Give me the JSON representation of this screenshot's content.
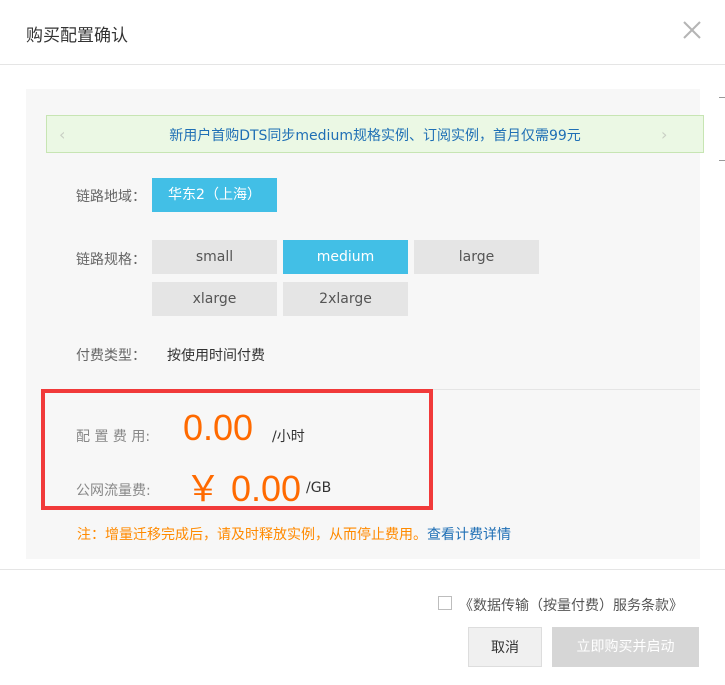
{
  "dialog": {
    "title": "购买配置确认"
  },
  "promo": {
    "text": "新用户首购DTS同步medium规格实例、订阅实例，首月仅需99元",
    "prev_glyph": "‹",
    "next_glyph": "›"
  },
  "region": {
    "label": "链路地域：",
    "selected": "华东2（上海）"
  },
  "spec": {
    "label": "链路规格：",
    "options": [
      "small",
      "medium",
      "large",
      "xlarge",
      "2xlarge"
    ],
    "selected": "medium"
  },
  "payment": {
    "label": "付费类型：",
    "value": "按使用时间付费"
  },
  "fees": {
    "config_label": "配 置 费 用:",
    "config_value": "0.00",
    "config_unit": "/小时",
    "traffic_label": "公网流量费:",
    "traffic_value": "￥ 0.00",
    "traffic_unit": "/GB"
  },
  "note": {
    "text": "注：增量迁移完成后，请及时释放实例，从而停止费用。",
    "link": "查看计费详情"
  },
  "footer": {
    "terms_text": "《数据传输（按量付费）服务条款》",
    "terms_checked": false,
    "cancel_label": "取消",
    "buy_label": "立即购买并启动"
  },
  "colors": {
    "accent": "#42bfe6",
    "price": "#ff6a00",
    "highlight_box": "#f13a3a",
    "link": "#1f6fb5",
    "note": "#ff8a00"
  },
  "icons": {
    "close": "close-icon",
    "prev": "chevron-left-icon",
    "next": "chevron-right-icon"
  }
}
